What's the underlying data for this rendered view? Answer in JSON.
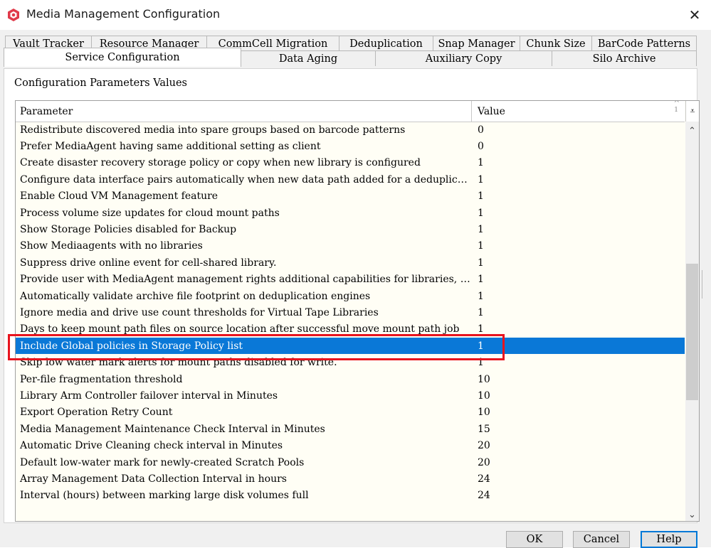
{
  "window": {
    "title": "Media Management Configuration",
    "close_symbol": "✕"
  },
  "tabs_back": [
    "Vault Tracker",
    "Resource Manager",
    "CommCell Migration",
    "Deduplication",
    "Snap Manager",
    "Chunk Size",
    "BarCode Patterns"
  ],
  "tabs_front": [
    "Service Configuration",
    "Data Aging",
    "Auxiliary Copy",
    "Silo Archive"
  ],
  "selected_tab": "Service Configuration",
  "group_label": "Configuration Parameters Values",
  "grid": {
    "headers": {
      "parameter": "Parameter",
      "value": "Value"
    },
    "sort_indicator": "1",
    "rows": [
      {
        "parameter": "Redistribute discovered media into spare groups based on barcode patterns",
        "value": "0"
      },
      {
        "parameter": "Prefer MediaAgent having same additional setting as client",
        "value": "0"
      },
      {
        "parameter": "Create disaster recovery storage policy or copy when new library is configured",
        "value": "1"
      },
      {
        "parameter": "Configure data interface pairs automatically when new data path added for a deduplication copy",
        "value": "1"
      },
      {
        "parameter": "Enable Cloud VM Management feature",
        "value": "1"
      },
      {
        "parameter": "Process volume size updates for cloud mount paths",
        "value": "1"
      },
      {
        "parameter": "Show Storage Policies disabled for Backup",
        "value": "1"
      },
      {
        "parameter": "Show Mediaagents with no libraries",
        "value": "1"
      },
      {
        "parameter": "Suppress drive online event for cell-shared library.",
        "value": "1"
      },
      {
        "parameter": "Provide user with MediaAgent management rights additional capabilities for libraries, data paths, and storage policies",
        "value": "1"
      },
      {
        "parameter": "Automatically validate archive file footprint on deduplication engines",
        "value": "1"
      },
      {
        "parameter": "Ignore media and drive use count thresholds for Virtual Tape Libraries",
        "value": "1"
      },
      {
        "parameter": "Days to keep mount path files on source location after successful move mount path job",
        "value": "1"
      },
      {
        "parameter": "Include Global policies in Storage Policy list",
        "value": "1",
        "selected": true
      },
      {
        "parameter": "Skip low water mark alerts for mount paths disabled for write.",
        "value": "1"
      },
      {
        "parameter": "Per-file fragmentation threshold",
        "value": "10"
      },
      {
        "parameter": "Library Arm Controller failover interval in Minutes",
        "value": "10"
      },
      {
        "parameter": "Export Operation Retry Count",
        "value": "10"
      },
      {
        "parameter": "Media Management Maintenance Check Interval in Minutes",
        "value": "15"
      },
      {
        "parameter": "Automatic Drive Cleaning check interval in Minutes",
        "value": "20"
      },
      {
        "parameter": "Default low-water mark for newly-created Scratch Pools",
        "value": "20"
      },
      {
        "parameter": "Array Management Data Collection Interval in hours",
        "value": "24"
      },
      {
        "parameter": "Interval (hours) between marking large disk volumes full",
        "value": "24"
      }
    ]
  },
  "buttons": {
    "ok": "OK",
    "cancel": "Cancel",
    "help": "Help"
  },
  "colors": {
    "selection": "#0a78d7",
    "highlight_box": "#e8141e",
    "grid_background": "#fffef5"
  }
}
